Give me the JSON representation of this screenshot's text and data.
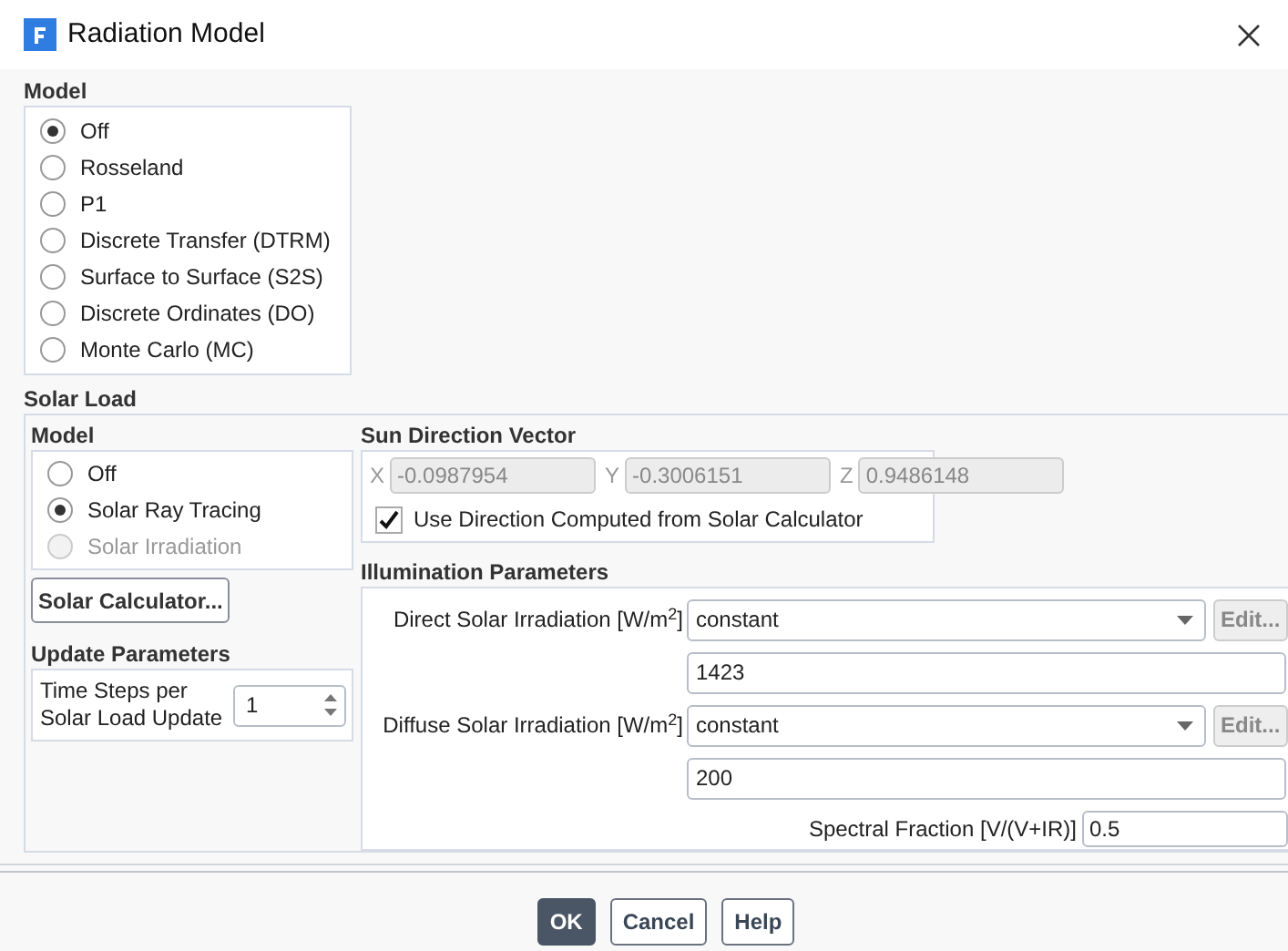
{
  "window": {
    "title": "Radiation Model"
  },
  "model": {
    "label": "Model",
    "options": [
      {
        "label": "Off",
        "selected": true,
        "disabled": false
      },
      {
        "label": "Rosseland",
        "selected": false,
        "disabled": false
      },
      {
        "label": "P1",
        "selected": false,
        "disabled": false
      },
      {
        "label": "Discrete Transfer (DTRM)",
        "selected": false,
        "disabled": false
      },
      {
        "label": "Surface to Surface (S2S)",
        "selected": false,
        "disabled": false
      },
      {
        "label": "Discrete Ordinates (DO)",
        "selected": false,
        "disabled": false
      },
      {
        "label": "Monte Carlo (MC)",
        "selected": false,
        "disabled": false
      }
    ]
  },
  "solar_load": {
    "label": "Solar Load",
    "model": {
      "label": "Model",
      "options": [
        {
          "label": "Off",
          "selected": false,
          "disabled": false
        },
        {
          "label": "Solar Ray Tracing",
          "selected": true,
          "disabled": false
        },
        {
          "label": "Solar Irradiation",
          "selected": false,
          "disabled": true
        }
      ]
    },
    "solar_calculator_button": "Solar Calculator...",
    "update_parameters": {
      "label": "Update Parameters",
      "time_steps": {
        "label": "Time Steps per Solar Load Update",
        "value": "1"
      }
    },
    "sun_direction": {
      "label": "Sun Direction Vector",
      "components": [
        {
          "label": "X",
          "value": "-0.0987954",
          "disabled": true
        },
        {
          "label": "Y",
          "value": "-0.3006151",
          "disabled": true
        },
        {
          "label": "Z",
          "value": "0.9486148",
          "disabled": true
        }
      ],
      "use_calculator": {
        "label": "Use Direction Computed from Solar Calculator",
        "checked": true
      }
    },
    "illumination": {
      "label": "Illumination Parameters",
      "rows": [
        {
          "kind": "dropdown",
          "label": "Direct Solar Irradiation [W/m$^{2}$]",
          "value": "constant",
          "button": "Edit..."
        },
        {
          "kind": "input",
          "value": "1423"
        },
        {
          "kind": "dropdown",
          "label": "Diffuse Solar Irradiation [W/m$^{2}$]",
          "value": "constant",
          "button": "Edit..."
        },
        {
          "kind": "input",
          "value": "200"
        },
        {
          "kind": "labeled_input",
          "label": "Spectral Fraction [V/(V+IR)]",
          "value": "0.5"
        }
      ]
    }
  },
  "buttons": [
    {
      "label": "OK",
      "primary": true
    },
    {
      "label": "Cancel",
      "primary": false
    },
    {
      "label": "Help",
      "primary": false
    }
  ]
}
